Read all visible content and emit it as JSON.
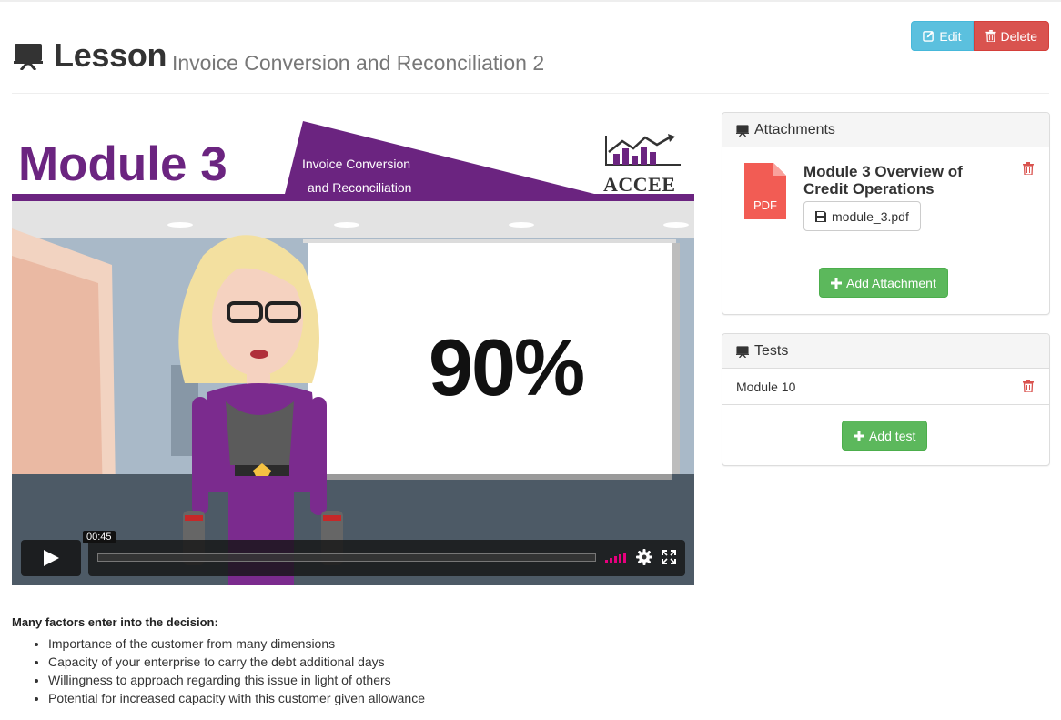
{
  "header": {
    "title": "Lesson",
    "subtitle": "Invoice Conversion and Reconciliation 2",
    "edit_label": "Edit",
    "delete_label": "Delete"
  },
  "video": {
    "banner_title": "Module 3",
    "banner_line1": "Invoice Conversion",
    "banner_line2": "and Reconciliation",
    "logo_text": "ACCEE",
    "slide_value": "90%",
    "current_time": "00:45",
    "progress": 0.0
  },
  "description": {
    "lead": "Many factors enter into the decision:",
    "bullets": [
      "Importance of the customer from many dimensions",
      "Capacity of your enterprise to carry the debt additional days",
      "Willingness to approach regarding this issue in light of others",
      "Potential for increased capacity with this customer given allowance"
    ]
  },
  "attachments": {
    "heading": "Attachments",
    "items": [
      {
        "title": "Module 3 Overview of Credit Operations",
        "file": "module_3.pdf",
        "icon_label": "PDF"
      }
    ],
    "add_label": "Add Attachment"
  },
  "tests": {
    "heading": "Tests",
    "items": [
      {
        "name": "Module 10"
      }
    ],
    "add_label": "Add test"
  },
  "colors": {
    "brand_purple": "#6b2480",
    "edit": "#5bc0de",
    "delete": "#d9534f",
    "add": "#5cb85c",
    "pdf": "#e74c3c"
  },
  "icons": [
    "presentation-icon",
    "edit-icon",
    "trash-icon",
    "pdf-file-icon",
    "floppy-disk-icon",
    "plus-icon",
    "play-icon",
    "volume-icon",
    "gear-icon",
    "fullscreen-icon"
  ]
}
